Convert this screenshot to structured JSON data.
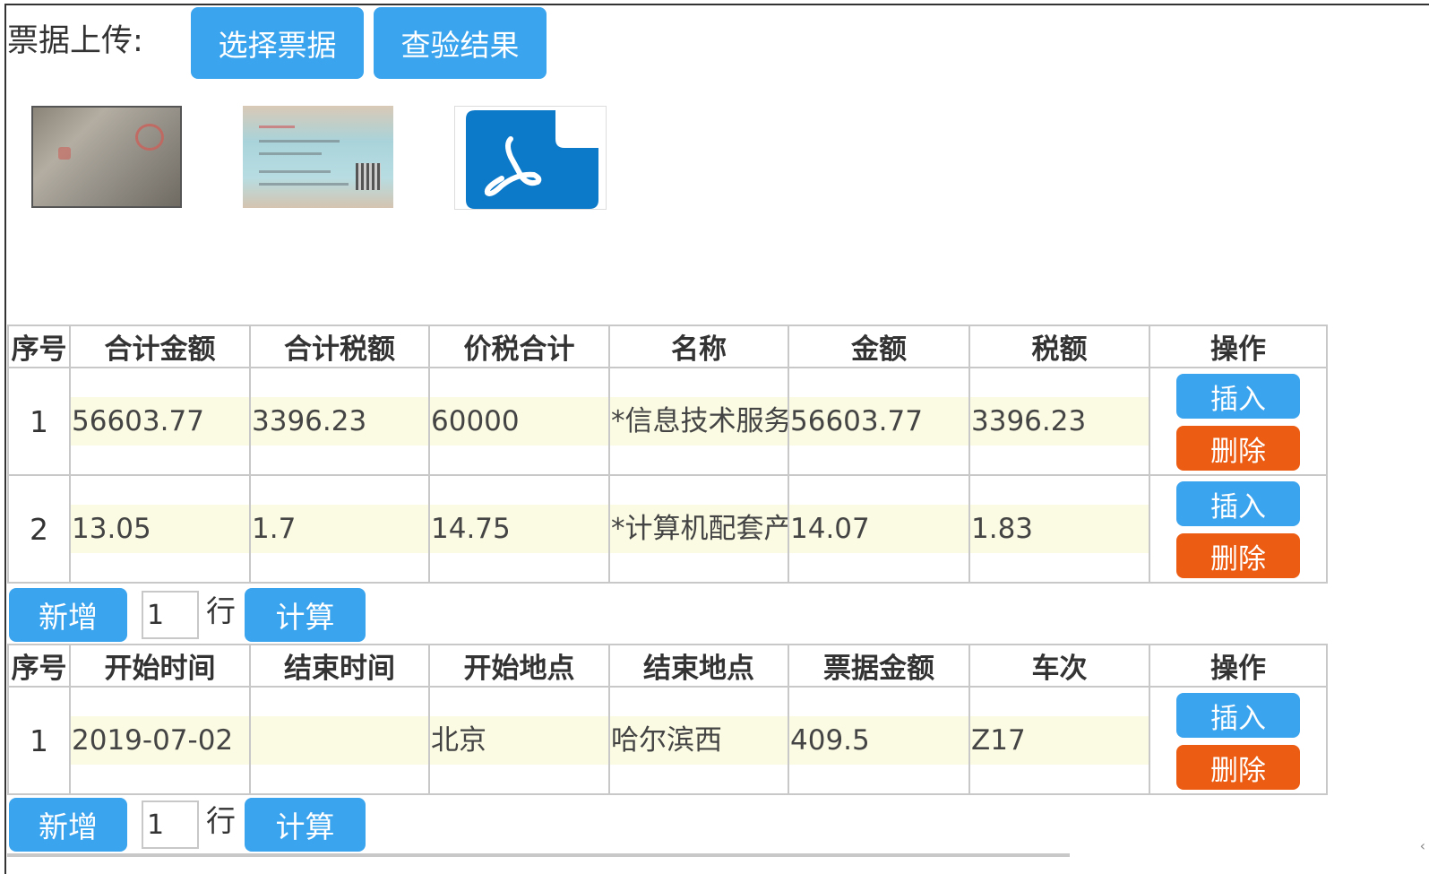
{
  "upload": {
    "label": "票据上传:",
    "select_button": "选择票据",
    "verify_button": "查验结果"
  },
  "thumbnails": [
    {
      "icon": "receipt-photo-thumbnail"
    },
    {
      "icon": "ticket-photo-thumbnail"
    },
    {
      "icon": "pdf-file-icon"
    }
  ],
  "colors": {
    "primary_button": "#3aa4ee",
    "delete_button": "#ec5d13",
    "cell_background": "#fbfbe3",
    "pdf_icon": "#0c79c9"
  },
  "invoice_table": {
    "headers": [
      "序号",
      "合计金额",
      "合计税额",
      "价税合计",
      "名称",
      "金额",
      "税额",
      "操作"
    ],
    "rows": [
      {
        "index": "1",
        "total_amount": "56603.77",
        "total_tax": "3396.23",
        "amount_with_tax": "60000",
        "name": "*信息技术服务",
        "amount": "56603.77",
        "tax": "3396.23"
      },
      {
        "index": "2",
        "total_amount": "13.05",
        "total_tax": "1.7",
        "amount_with_tax": "14.75",
        "name": "*计算机配套产",
        "amount": "14.07",
        "tax": "1.83"
      }
    ],
    "insert_label": "插入",
    "delete_label": "删除"
  },
  "invoice_add": {
    "add_button": "新增",
    "count_value": "1",
    "unit": "行",
    "calc_button": "计算"
  },
  "trip_table": {
    "headers": [
      "序号",
      "开始时间",
      "结束时间",
      "开始地点",
      "结束地点",
      "票据金额",
      "车次",
      "操作"
    ],
    "rows": [
      {
        "index": "1",
        "start_time": "2019-07-02",
        "end_time": "",
        "start_place": "北京",
        "end_place": "哈尔滨西",
        "ticket_amount": "409.5",
        "train_no": "Z17"
      }
    ],
    "insert_label": "插入",
    "delete_label": "删除"
  },
  "trip_add": {
    "add_button": "新增",
    "count_value": "1",
    "unit": "行",
    "calc_button": "计算"
  }
}
